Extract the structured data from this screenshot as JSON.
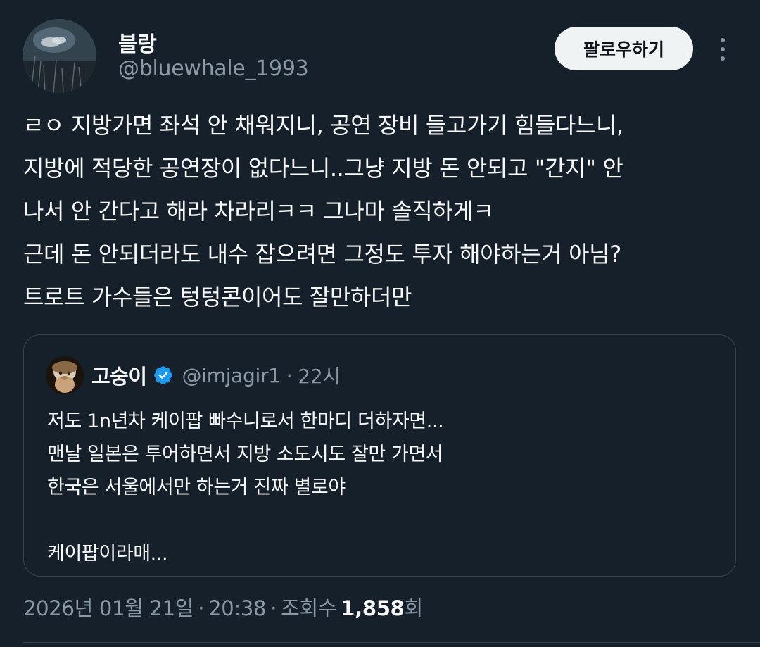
{
  "author": {
    "display_name": "블랑",
    "handle": "@bluewhale_1993"
  },
  "actions": {
    "follow_label": "팔로우하기",
    "more_icon": "more-dots-icon"
  },
  "tweet": {
    "lines": [
      "ㄹㅇ 지방가면 좌석 안 채워지니, 공연 장비 들고가기 힘들다느니,",
      "지방에 적당한 공연장이 없다느니..그냥 지방 돈 안되고 \"간지\" 안",
      "나서 안 간다고 해라 차라리ㅋㅋ 그나마 솔직하게ㅋ",
      "근데 돈 안되더라도 내수 잡으려면 그정도 투자 해야하는거 아님?",
      "트로트 가수들은 텅텅콘이어도 잘만하더만"
    ]
  },
  "quote": {
    "display_name": "고숭이",
    "verified_icon": "verified-badge-icon",
    "handle": "@imjagir1",
    "separator": "·",
    "time": "22시",
    "lines": [
      "저도 1n년차 케이팝 빠수니로서 한마디 더하자면...",
      "맨날 일본은 투어하면서 지방 소도시도 잘만 가면서",
      "한국은 서울에서만 하는거 진짜 별로야",
      "",
      "케이팝이라매..."
    ]
  },
  "meta": {
    "date": "2026년 01월 21일",
    "separator": "·",
    "time": "20:38",
    "views_label": "조회수",
    "views_count": "1,858",
    "views_suffix": "회"
  },
  "colors": {
    "background": "#15202b",
    "text_primary": "#f7f9f9",
    "text_secondary": "#8b98a5",
    "border": "#38444d",
    "verified": "#1d9bf0",
    "follow_bg": "#eff3f4"
  }
}
